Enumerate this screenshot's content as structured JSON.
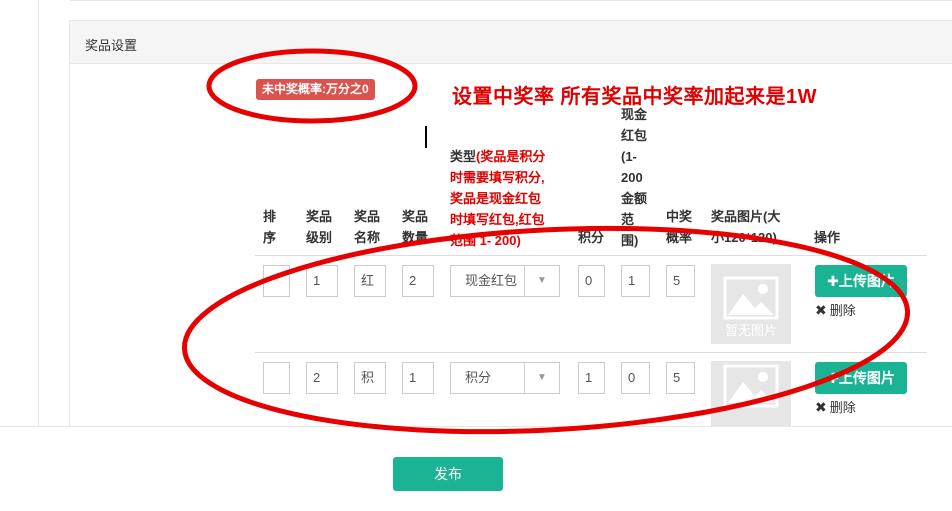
{
  "panel": {
    "title": "奖品设置"
  },
  "badge": "未中奖概率:万分之0",
  "annotation": "设置中奖率 所有奖品中奖率加起来是1W",
  "headers": {
    "sort": [
      "排",
      "序"
    ],
    "level": [
      "奖品",
      "级别"
    ],
    "name": [
      "奖品",
      "名称"
    ],
    "qty": [
      "奖品",
      "数量"
    ],
    "type_label": "类型",
    "type_note": [
      "(奖品是积分",
      "时需要填写积分,",
      "奖品是现金红包",
      "时填写红包,红包",
      "范围 1- 200)"
    ],
    "points": "积分",
    "cash": [
      "现金",
      "红包",
      "(1-",
      "200",
      "金额",
      "范",
      "围)"
    ],
    "rate": [
      "中奖",
      "概率"
    ],
    "image": [
      "奖品图片(大",
      "小120*120)"
    ],
    "action": "操作"
  },
  "rows": [
    {
      "sort": "",
      "level": "1",
      "name": "红",
      "qty": "2",
      "type": "现金红包",
      "points": "0",
      "cash": "1",
      "rate": "5",
      "image_text": "暂无图片"
    },
    {
      "sort": "",
      "level": "2",
      "name": "积",
      "qty": "1",
      "type": "积分",
      "points": "1",
      "cash": "0",
      "rate": "5",
      "image_text": "暂无图片"
    }
  ],
  "buttons": {
    "upload": "上传图片",
    "delete": "删除",
    "publish": "发布"
  },
  "colors": {
    "primary": "#1ab394",
    "danger": "#d9534f",
    "annotation": "#e00000"
  }
}
